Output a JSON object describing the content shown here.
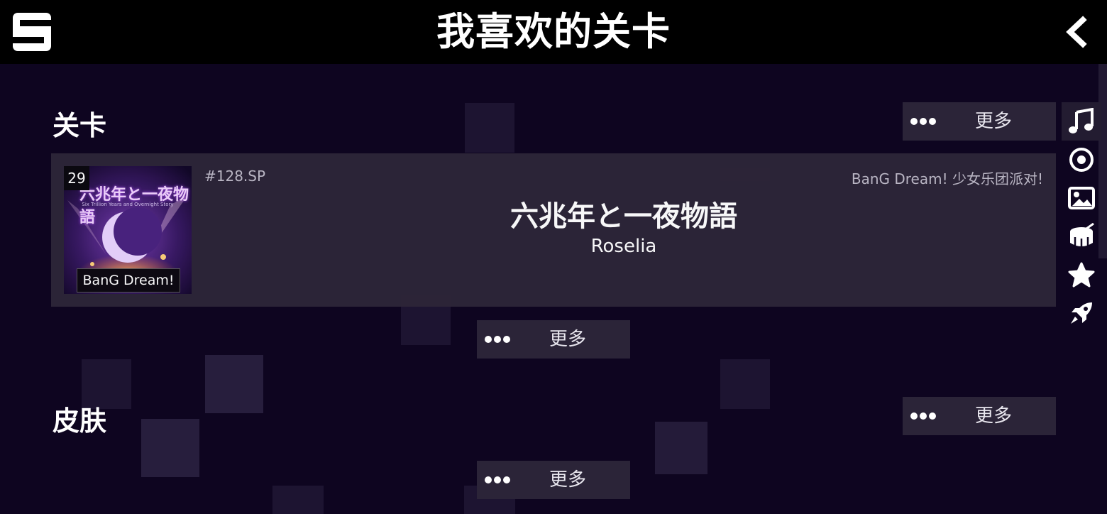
{
  "header": {
    "title": "我喜欢的关卡",
    "logo_icon": "app-logo-s-icon",
    "back_icon": "chevron-left-icon"
  },
  "sections": {
    "levels": {
      "title": "关卡",
      "more_label": "更多",
      "bottom_more_label": "更多"
    },
    "skins": {
      "title": "皮肤",
      "more_label": "更多",
      "bottom_more_label": "更多"
    }
  },
  "level_card": {
    "badge": "29",
    "id": "#128.SP",
    "source": "BanG Dream! 少女乐团派对!",
    "title": "六兆年と一夜物語",
    "artist": "Roselia",
    "cover": {
      "jp_text": "六兆年と一夜物語",
      "sub_text": "Six Trillion Years and Overnight Story",
      "label": "BanG Dream!"
    }
  },
  "side_nav": [
    {
      "icon": "music-note-icon",
      "active": true
    },
    {
      "icon": "disc-icon",
      "active": false
    },
    {
      "icon": "image-icon",
      "active": false
    },
    {
      "icon": "drum-icon",
      "active": false
    },
    {
      "icon": "star-icon",
      "active": false
    },
    {
      "icon": "rocket-icon",
      "active": false
    }
  ],
  "colors": {
    "background": "#0e0520",
    "topbar": "#000000",
    "card": "#2c2538",
    "button": "#2b2438"
  }
}
